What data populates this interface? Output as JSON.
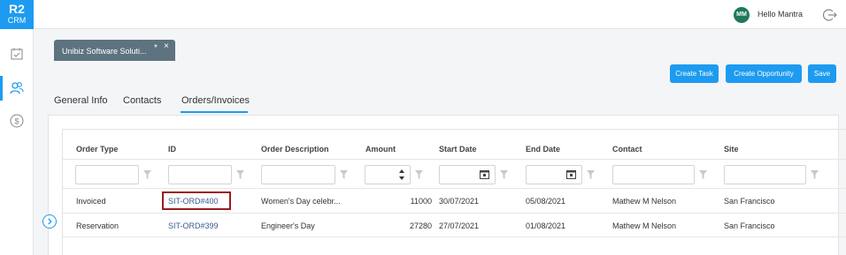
{
  "app": {
    "logo_line1": "R2",
    "logo_line2": "CRM"
  },
  "sidebar": {
    "items": [
      {
        "name": "tasks-icon",
        "active": false
      },
      {
        "name": "contacts-icon",
        "active": true
      },
      {
        "name": "dollar-icon",
        "active": false
      }
    ]
  },
  "topbar": {
    "avatar_initials": "MM",
    "greeting": "Hello Mantra"
  },
  "record_tab": {
    "title": "Unibiz Software Soluti...",
    "modified_marker": "*",
    "close_glyph": "×"
  },
  "actions": {
    "create_task": "Create Task",
    "create_opportunity": "Create Opportunity",
    "save": "Save"
  },
  "tabs": [
    {
      "label": "General Info",
      "active": false
    },
    {
      "label": "Contacts",
      "active": false
    },
    {
      "label": "Orders/Invoices",
      "active": true
    }
  ],
  "grid": {
    "columns": [
      "Order Type",
      "ID",
      "Order Description",
      "Amount",
      "Start Date",
      "End Date",
      "Contact",
      "Site"
    ],
    "rows": [
      {
        "order_type": "Invoiced",
        "id": "SIT-ORD#400",
        "description": "Women's Day celebr...",
        "amount": "11000",
        "start_date": "30/07/2021",
        "end_date": "05/08/2021",
        "contact": "Mathew M Nelson",
        "site": "San Francisco"
      },
      {
        "order_type": "Reservation",
        "id": "SIT-ORD#399",
        "description": "Engineer's Day",
        "amount": "27280",
        "start_date": "27/07/2021",
        "end_date": "01/08/2021",
        "contact": "Mathew M Nelson",
        "site": "San Francisco"
      }
    ]
  },
  "colors": {
    "accent": "#1d9bf0",
    "tab_bg": "#5e7380",
    "avatar_bg": "#1f7a5a",
    "highlight": "#9b1c1c"
  }
}
